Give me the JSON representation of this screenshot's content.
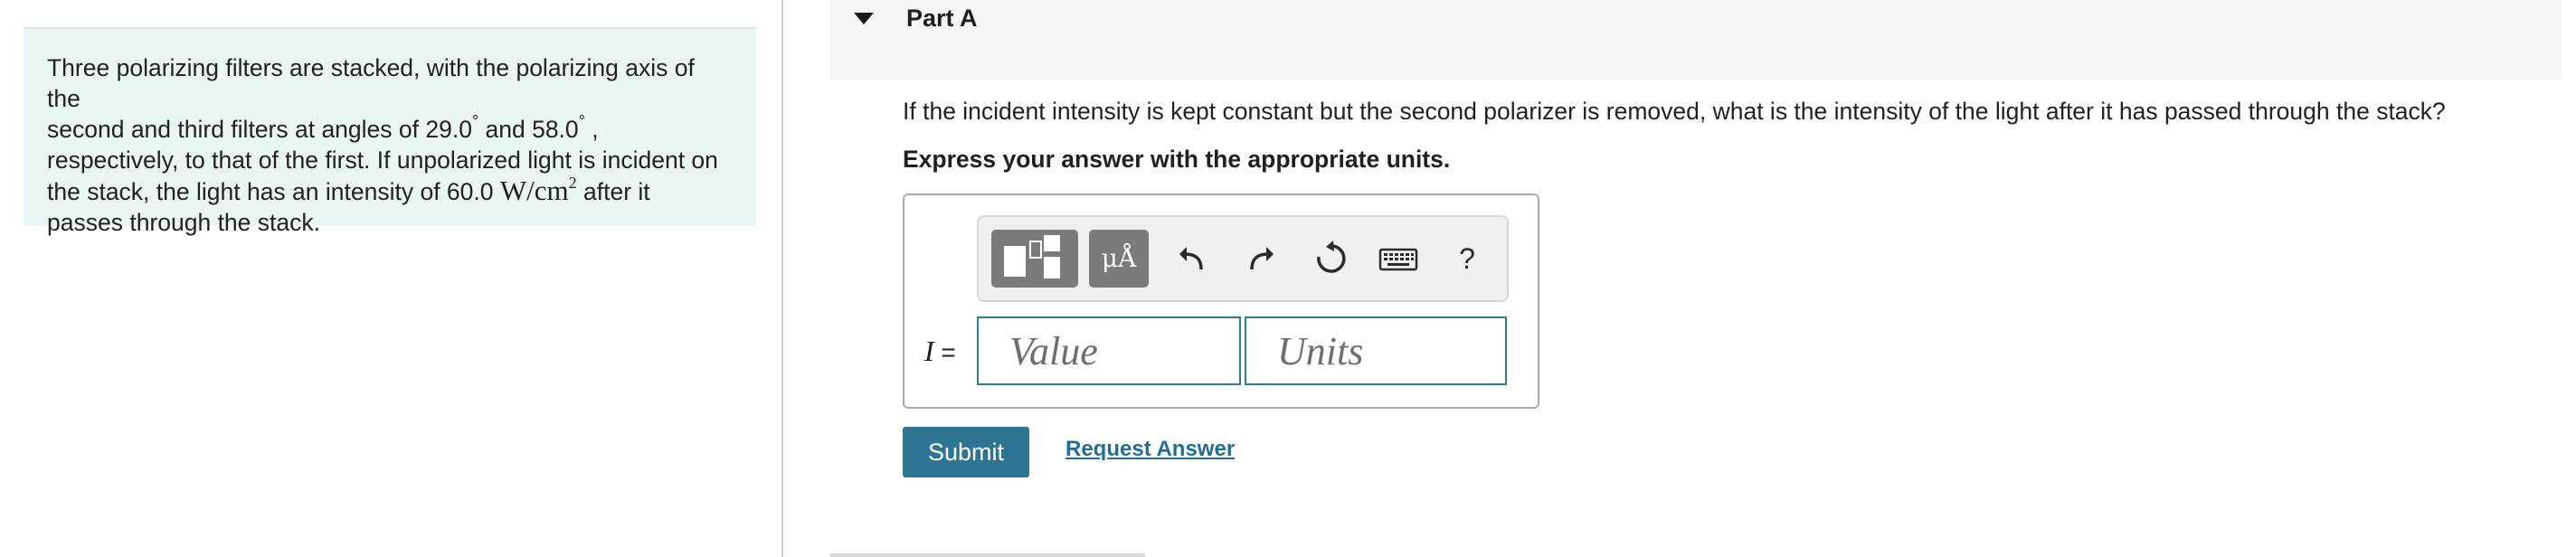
{
  "problem": {
    "text_1": "Three polarizing filters are stacked, with the polarizing axis of the",
    "text_2": "second and third filters at angles of 29.0",
    "angle_sep": " and 58.0",
    "text_3": "respectively, to that of the first. If unpolarized light is incident on",
    "text_4": "the stack, the light has an intensity of 60.0 ",
    "unit_main": "W/cm",
    "unit_exp": "2",
    "text_5": " after it",
    "text_6": "passes through the stack.",
    "degree": "°",
    "comma": " ,"
  },
  "part": {
    "title": "Part A"
  },
  "question": "If the incident intensity is kept constant but the second polarizer is removed, what is the intensity of the light after it has passed through the stack?",
  "instruction": "Express your answer with the appropriate units.",
  "toolbar": {
    "units_label": "μÅ",
    "help_label": "?",
    "icons": [
      "templates-icon",
      "units-icon",
      "undo-icon",
      "redo-icon",
      "reset-icon",
      "keyboard-icon",
      "help-icon"
    ]
  },
  "answer": {
    "variable": "I",
    "equals": " =",
    "value_placeholder": "Value",
    "units_placeholder": "Units"
  },
  "actions": {
    "submit_label": "Submit",
    "request_label": "Request Answer"
  },
  "colors": {
    "problem_bg": "#e9f6f5",
    "accent": "#2e7593",
    "link": "#1f6f9e"
  }
}
